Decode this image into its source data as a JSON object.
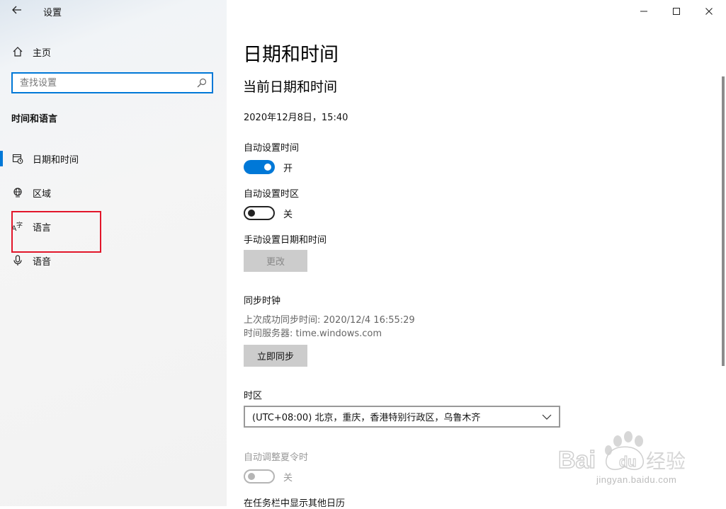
{
  "window": {
    "title": "设置"
  },
  "sidebar": {
    "home_label": "主页",
    "search_placeholder": "查找设置",
    "section_title": "时间和语言",
    "items": [
      {
        "label": "日期和时间",
        "icon": "calendar-clock-icon",
        "selected": true
      },
      {
        "label": "区域",
        "icon": "globe-icon"
      },
      {
        "label": "语言",
        "icon": "language-icon"
      },
      {
        "label": "语音",
        "icon": "microphone-icon"
      }
    ]
  },
  "main": {
    "title": "日期和时间",
    "current_heading": "当前日期和时间",
    "current_datetime": "2020年12月8日，15:40",
    "auto_time": {
      "label": "自动设置时间",
      "state": "开",
      "on": true
    },
    "auto_timezone": {
      "label": "自动设置时区",
      "state": "关",
      "on": false
    },
    "manual": {
      "label": "手动设置日期和时间",
      "button": "更改"
    },
    "sync": {
      "heading": "同步时钟",
      "last_sync": "上次成功同步时间: 2020/12/4 16:55:29",
      "server": "时间服务器: time.windows.com",
      "button": "立即同步"
    },
    "timezone": {
      "label": "时区",
      "value": "(UTC+08:00) 北京，重庆，香港特别行政区，乌鲁木齐"
    },
    "dst": {
      "label": "自动调整夏令时",
      "state": "关",
      "on": false
    },
    "taskbar_calendar": {
      "label": "在任务栏中显示其他日历"
    }
  },
  "watermark": {
    "text": "Baidu经验",
    "sub": "jingyan.baidu.com"
  },
  "colors": {
    "accent": "#0078d7",
    "highlight_box": "#e2162a",
    "button_bg": "#cccccc"
  }
}
